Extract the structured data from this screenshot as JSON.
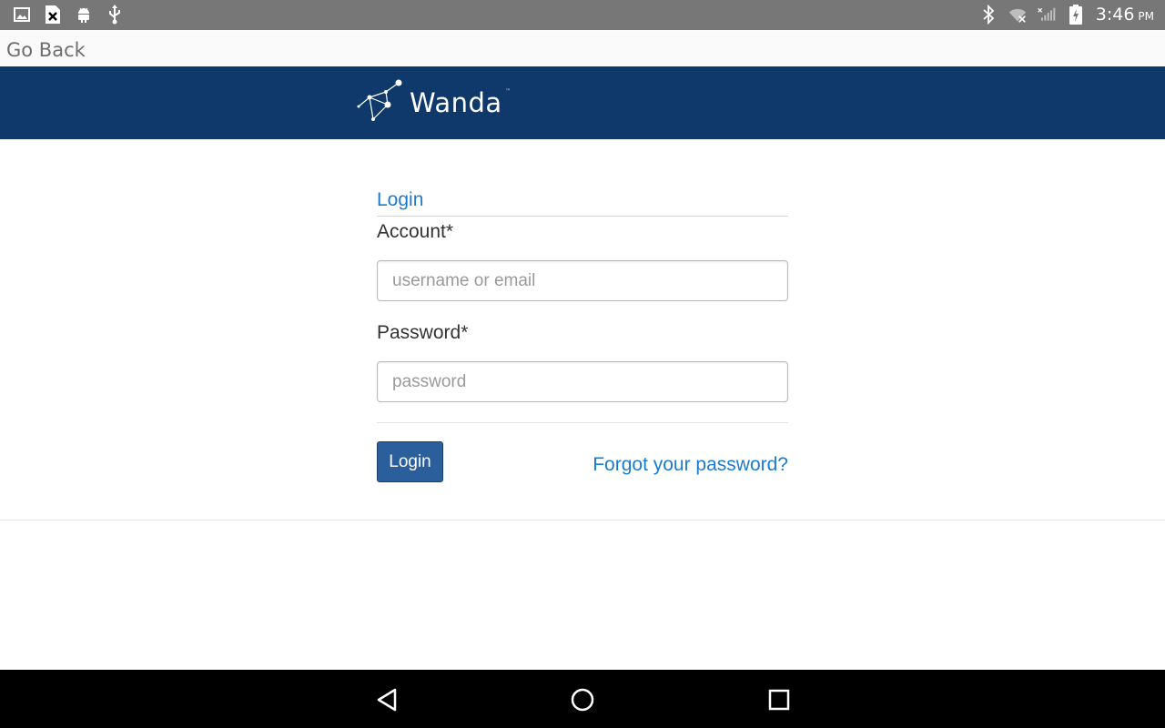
{
  "status_bar": {
    "left_icons": [
      "image-icon",
      "close-file-icon",
      "android-icon",
      "usb-icon"
    ],
    "right_icons": [
      "bluetooth-icon",
      "wifi-icon",
      "cellular-signal-icon",
      "battery-charging-icon"
    ],
    "time": "3:46",
    "ampm": "PM"
  },
  "nav": {
    "go_back": "Go Back"
  },
  "header": {
    "logo_text": "Wanda",
    "logo_tm": "™",
    "background": "#0f396b"
  },
  "form": {
    "title": "Login",
    "account_label": "Account*",
    "account_placeholder": "username or email",
    "account_value": "",
    "password_label": "Password*",
    "password_placeholder": "password",
    "password_value": "",
    "login_button": "Login",
    "forgot_link": "Forgot your password?"
  },
  "colors": {
    "link": "#1a7bd0",
    "button": "#2b5f9c",
    "status_bar": "#777777"
  },
  "system_nav": {
    "icons": [
      "back-icon",
      "home-icon",
      "recents-icon"
    ]
  }
}
